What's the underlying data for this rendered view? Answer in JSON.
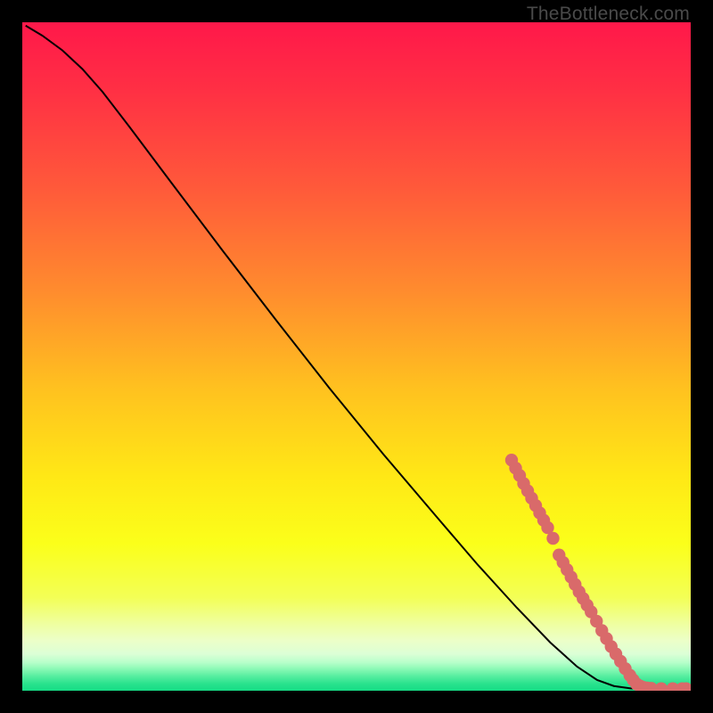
{
  "watermark": "TheBottleneck.com",
  "colors": {
    "bg_black": "#000000",
    "marker_fill": "#d96a6a",
    "marker_stroke": "#c05050",
    "curve": "#000000"
  },
  "chart_data": {
    "type": "line",
    "title": "",
    "xlabel": "",
    "ylabel": "",
    "xlim": [
      0,
      100
    ],
    "ylim": [
      0,
      100
    ],
    "gradient_stops": [
      {
        "offset": 0.0,
        "color": "#ff184a"
      },
      {
        "offset": 0.1,
        "color": "#ff2f44"
      },
      {
        "offset": 0.25,
        "color": "#ff5a3a"
      },
      {
        "offset": 0.4,
        "color": "#ff8b2e"
      },
      {
        "offset": 0.55,
        "color": "#ffc21f"
      },
      {
        "offset": 0.68,
        "color": "#ffe816"
      },
      {
        "offset": 0.78,
        "color": "#fbff1a"
      },
      {
        "offset": 0.86,
        "color": "#f3ff55"
      },
      {
        "offset": 0.9,
        "color": "#efffa0"
      },
      {
        "offset": 0.925,
        "color": "#ecffc8"
      },
      {
        "offset": 0.945,
        "color": "#dcffd6"
      },
      {
        "offset": 0.958,
        "color": "#b6ffca"
      },
      {
        "offset": 0.968,
        "color": "#88f9b4"
      },
      {
        "offset": 0.978,
        "color": "#58eea0"
      },
      {
        "offset": 0.99,
        "color": "#28e28d"
      },
      {
        "offset": 1.0,
        "color": "#16dc85"
      }
    ],
    "series": [
      {
        "name": "bottleneck-curve",
        "type": "line",
        "points": [
          {
            "x": 0.5,
            "y": 99.5
          },
          {
            "x": 3.0,
            "y": 98.0
          },
          {
            "x": 6.0,
            "y": 95.8
          },
          {
            "x": 9.0,
            "y": 93.0
          },
          {
            "x": 12.0,
            "y": 89.6
          },
          {
            "x": 16.0,
            "y": 84.4
          },
          {
            "x": 22.0,
            "y": 76.4
          },
          {
            "x": 30.0,
            "y": 65.8
          },
          {
            "x": 38.0,
            "y": 55.4
          },
          {
            "x": 46.0,
            "y": 45.2
          },
          {
            "x": 54.0,
            "y": 35.4
          },
          {
            "x": 62.0,
            "y": 26.0
          },
          {
            "x": 68.0,
            "y": 19.0
          },
          {
            "x": 74.0,
            "y": 12.4
          },
          {
            "x": 79.0,
            "y": 7.2
          },
          {
            "x": 83.0,
            "y": 3.6
          },
          {
            "x": 86.0,
            "y": 1.6
          },
          {
            "x": 88.5,
            "y": 0.7
          },
          {
            "x": 91.0,
            "y": 0.35
          },
          {
            "x": 95.0,
            "y": 0.25
          },
          {
            "x": 100.0,
            "y": 0.25
          }
        ]
      },
      {
        "name": "highlighted-points",
        "type": "scatter",
        "points": [
          {
            "x": 73.2,
            "y": 34.5
          },
          {
            "x": 73.8,
            "y": 33.3
          },
          {
            "x": 74.4,
            "y": 32.2
          },
          {
            "x": 75.0,
            "y": 31.0
          },
          {
            "x": 75.6,
            "y": 29.9
          },
          {
            "x": 76.2,
            "y": 28.8
          },
          {
            "x": 76.8,
            "y": 27.7
          },
          {
            "x": 77.4,
            "y": 26.6
          },
          {
            "x": 78.0,
            "y": 25.5
          },
          {
            "x": 78.6,
            "y": 24.4
          },
          {
            "x": 79.4,
            "y": 22.8
          },
          {
            "x": 80.3,
            "y": 20.3
          },
          {
            "x": 80.9,
            "y": 19.2
          },
          {
            "x": 81.5,
            "y": 18.1
          },
          {
            "x": 82.1,
            "y": 17.0
          },
          {
            "x": 82.7,
            "y": 15.9
          },
          {
            "x": 83.3,
            "y": 14.8
          },
          {
            "x": 83.9,
            "y": 13.8
          },
          {
            "x": 84.5,
            "y": 12.8
          },
          {
            "x": 85.1,
            "y": 11.8
          },
          {
            "x": 85.9,
            "y": 10.4
          },
          {
            "x": 86.7,
            "y": 9.0
          },
          {
            "x": 87.4,
            "y": 7.8
          },
          {
            "x": 88.1,
            "y": 6.6
          },
          {
            "x": 88.8,
            "y": 5.5
          },
          {
            "x": 89.5,
            "y": 4.4
          },
          {
            "x": 90.2,
            "y": 3.3
          },
          {
            "x": 90.9,
            "y": 2.3
          },
          {
            "x": 91.4,
            "y": 1.6
          },
          {
            "x": 91.9,
            "y": 1.0
          },
          {
            "x": 92.4,
            "y": 0.7
          },
          {
            "x": 92.9,
            "y": 0.5
          },
          {
            "x": 93.5,
            "y": 0.4
          },
          {
            "x": 94.1,
            "y": 0.35
          },
          {
            "x": 95.6,
            "y": 0.3
          },
          {
            "x": 97.3,
            "y": 0.3
          },
          {
            "x": 98.7,
            "y": 0.3
          },
          {
            "x": 99.3,
            "y": 0.3
          }
        ]
      }
    ]
  }
}
